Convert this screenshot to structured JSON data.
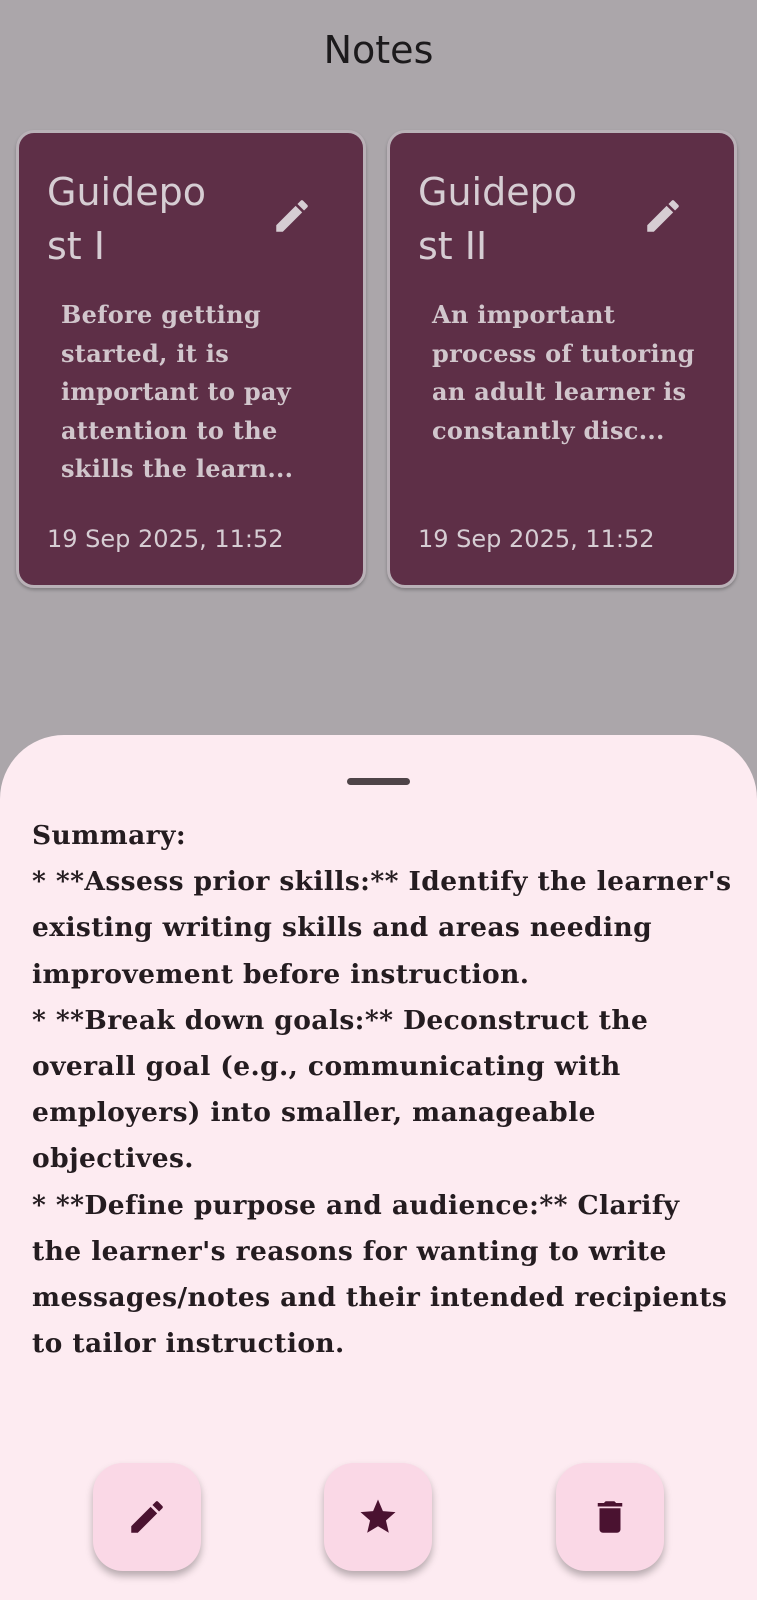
{
  "app": {
    "title": "Notes"
  },
  "notes": [
    {
      "title": "Guidepo\nst I",
      "preview": "Before getting started, it is important to pay attention to the skills the learn...",
      "date": "19 Sep 2025, 11:52",
      "icon": "edit-icon"
    },
    {
      "title": "Guidepo\nst II",
      "preview": "An important process of tutoring an adult learner is constantly disc...",
      "date": "19 Sep 2025, 11:52",
      "icon": "edit-icon"
    }
  ],
  "sheet": {
    "content": "Summary:\n* **Assess prior skills:** Identify the learner's existing writing skills and areas needing improvement before instruction.\n* **Break down goals:**  Deconstruct the overall goal (e.g., communicating with employers) into smaller, manageable objectives.\n* **Define purpose and audience:** Clarify the learner's reasons for wanting to write messages/notes and their intended recipients to tailor instruction.",
    "actions": [
      {
        "name": "edit",
        "icon": "pencil-icon"
      },
      {
        "name": "favorite",
        "icon": "star-icon"
      },
      {
        "name": "delete",
        "icon": "trash-icon"
      }
    ]
  },
  "colors": {
    "background_dimmed": "#aba6aa",
    "card": "#5e2f47",
    "card_border": "#b9b1b7",
    "card_text": "#d6cdd3",
    "sheet": "#fdebf1",
    "sheet_text": "#241c20",
    "action_button": "#fad8e6",
    "icon": "#4a1230"
  }
}
